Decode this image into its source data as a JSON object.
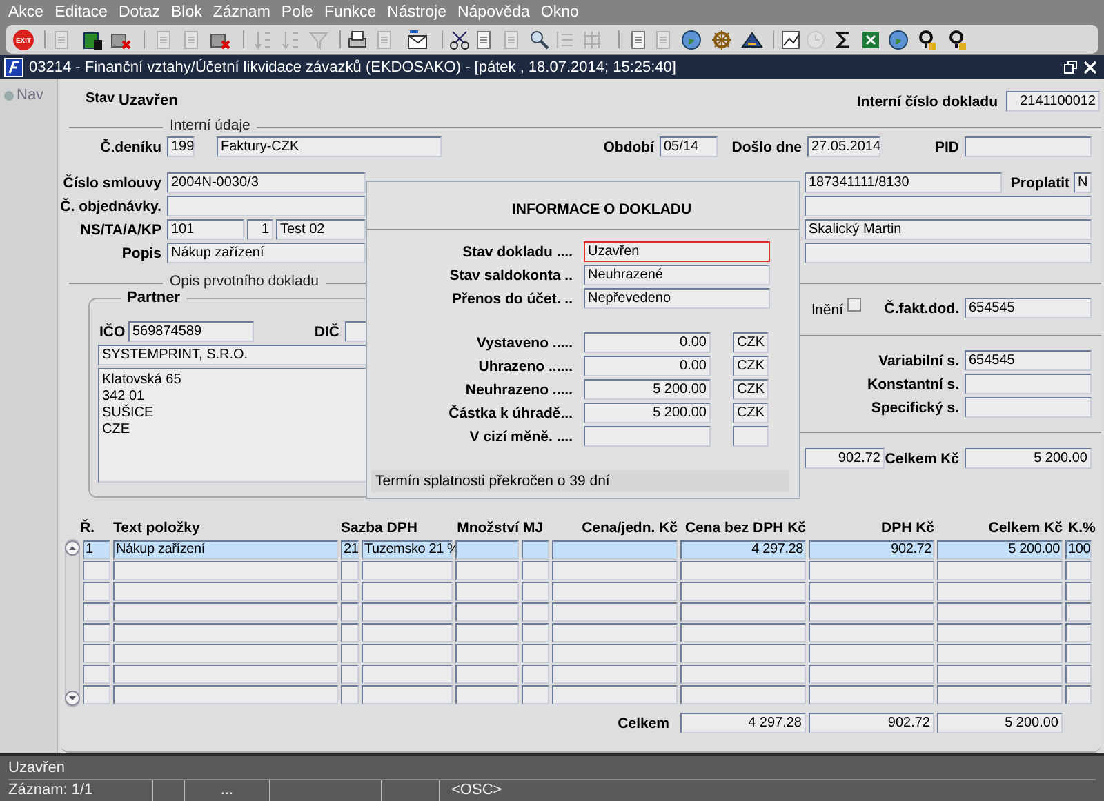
{
  "menu": [
    "Akce",
    "Editace",
    "Dotaz",
    "Blok",
    "Záznam",
    "Pole",
    "Funkce",
    "Nástroje",
    "Nápověda",
    "Okno"
  ],
  "toolbar": [
    {
      "label": "EXIT",
      "disabled": false
    },
    {
      "disabled": true
    },
    {
      "disabled": false
    },
    {
      "disabled": false
    },
    {
      "disabled": true
    },
    {
      "disabled": true
    },
    {
      "disabled": false
    },
    {
      "disabled": true
    },
    {
      "disabled": true
    },
    {
      "disabled": true
    },
    {
      "disabled": false
    },
    {
      "disabled": true
    },
    {
      "disabled": false
    },
    {
      "disabled": false
    },
    {
      "disabled": false
    },
    {
      "disabled": true
    },
    {
      "disabled": false
    },
    {
      "disabled": true
    },
    {
      "disabled": true
    },
    {
      "disabled": false
    },
    {
      "disabled": true
    },
    {
      "disabled": false
    },
    {
      "disabled": false
    },
    {
      "disabled": false
    },
    {
      "disabled": false
    },
    {
      "disabled": true
    },
    {
      "disabled": false
    },
    {
      "disabled": false
    },
    {
      "disabled": false
    },
    {
      "disabled": false
    },
    {
      "disabled": false
    }
  ],
  "window": {
    "title": "03214 - Finanční vztahy/Účetní likvidace závazků (EKDOSAKO) - [pátek , 18.07.2014; 15:25:40]"
  },
  "nav": {
    "label": "Nav",
    "disabled": true
  },
  "header": {
    "status_label": "Stav",
    "status": "Uzavřen",
    "doc_label": "Interní číslo dokladu",
    "doc_number": "2141100012"
  },
  "internal": {
    "title": "Interní údaje",
    "fields": [
      {
        "label": "Č.deníku",
        "value": "199"
      },
      {
        "value": "Faktury-CZK"
      },
      {
        "label": "Období",
        "value": "05/14"
      },
      {
        "label": "Došlo dne",
        "value": "27.05.2014"
      },
      {
        "label": "PID"
      }
    ]
  },
  "contract": [
    {
      "label": "Číslo smlouvy",
      "value": "2004N-0030/3"
    },
    {
      "label": "Č. objednávky."
    },
    {
      "label": "NS/TA/A/KP",
      "value": "101"
    },
    {
      "value": "1"
    },
    {
      "value": "Test 02"
    },
    {
      "label": "Popis",
      "value": "Nákup zařízení"
    },
    {
      "value": "187341111/8130"
    },
    {
      "label": "Proplatit",
      "value": "N"
    },
    {
      "value": "Skalický Martin"
    }
  ],
  "source": {
    "title": "Opis prvotního dokladu",
    "partner": {
      "title": "Partner",
      "ico_label": "IČO",
      "ico": "569874589",
      "dic_label": "DIČ",
      "name": "SYSTEMPRINT, S.R.O.",
      "address": [
        "Klatovská 65",
        "342 01",
        "SUŠICE",
        "CZE"
      ]
    }
  },
  "right": {
    "checkbox_label": "lnění",
    "checked": false,
    "invoice_label": "Č.fakt.dod.",
    "invoice": "654545",
    "symbols": [
      {
        "label": "Variabilní s.",
        "value": "654545"
      },
      {
        "label": "Konstantní s."
      },
      {
        "label": "Specifický s."
      }
    ],
    "vat": "902.72",
    "total_label": "Celkem Kč",
    "total": "5 200.00"
  },
  "info_dialog": {
    "title": "INFORMACE O DOKLADU",
    "states": [
      {
        "label": "Stav dokladu ....",
        "value": "Uzavřen",
        "focused": true
      },
      {
        "label": "Stav saldokonta ..",
        "value": "Neuhrazené",
        "focused": false
      },
      {
        "label": "Přenos do účet. ..",
        "value": "Nepřevedeno",
        "focused": false
      }
    ],
    "amounts": [
      {
        "label": "Vystaveno .....",
        "value": "0.00",
        "currency": "CZK"
      },
      {
        "label": "Uhrazeno ......",
        "value": "0.00",
        "currency": "CZK"
      },
      {
        "label": "Neuhrazeno .....",
        "value": "5 200.00",
        "currency": "CZK"
      },
      {
        "label": "Částka k úhradě...",
        "value": "5 200.00",
        "currency": "CZK"
      },
      {
        "label": "V cizí měně. ...."
      }
    ],
    "message": "Termín splatnosti překročen o 39 dní"
  },
  "items": {
    "columns": [
      "Ř.",
      "Text položky",
      "Sazba DPH",
      "Množství",
      "MJ",
      "Cena/jedn. Kč",
      "Cena bez DPH Kč",
      "DPH Kč",
      "Celkem Kč",
      "K.%"
    ],
    "rows": [
      {
        "selected": true,
        "r": "1",
        "text": "Nákup zařízení",
        "rate": "21",
        "rate_name": "Tuzemsko 21 %",
        "net": "4 297.28",
        "vat": "902.72",
        "total": "5 200.00",
        "k": "100"
      },
      {
        "selected": false
      },
      {
        "selected": false
      },
      {
        "selected": false
      },
      {
        "selected": false
      },
      {
        "selected": false
      },
      {
        "selected": false
      },
      {
        "selected": false
      }
    ],
    "totals": {
      "label": "Celkem",
      "net": "4 297.28",
      "vat": "902.72",
      "total": "5 200.00"
    }
  },
  "status": {
    "message": "Uzavřen",
    "record": "Záznam: 1/1",
    "ellipsis": "...",
    "mode": "<OSC>"
  }
}
